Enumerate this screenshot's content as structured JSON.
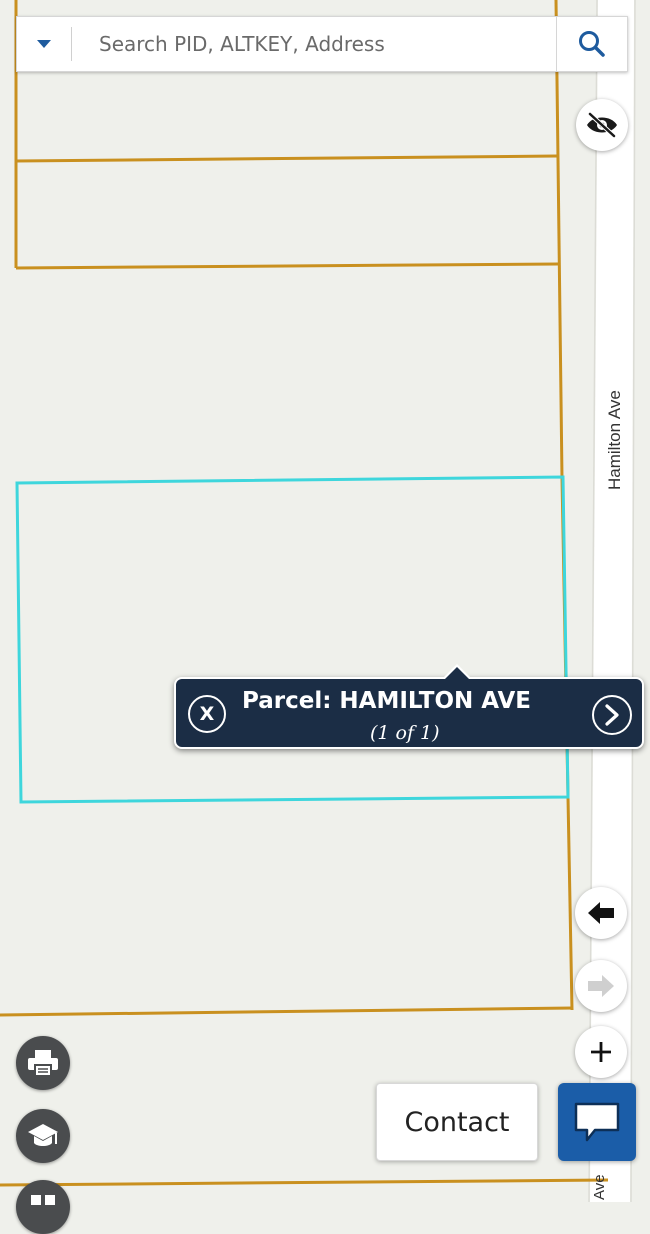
{
  "search": {
    "placeholder": "Search PID, ALTKEY, Address"
  },
  "map": {
    "street_label": "Hamilton Ave",
    "street_label_bottom": "Ave",
    "colors": {
      "background": "#eff0eb",
      "parcel_line": "#c9901f",
      "selected_parcel": "#3ed6dc",
      "road": "#ffffff"
    }
  },
  "popup": {
    "close_label": "X",
    "title": "Parcel: HAMILTON AVE",
    "subtitle": "(1 of 1)"
  },
  "buttons": {
    "contact_label": "Contact"
  },
  "icons": {
    "search_dropdown": "caret-down-icon",
    "search": "search-icon",
    "hide_layers": "eye-slash-icon",
    "back": "arrow-left-icon",
    "forward": "arrow-right-icon",
    "zoom_in": "plus-icon",
    "print": "printer-icon",
    "tools": "graduation-cap-icon",
    "chat": "chat-bubble-icon"
  },
  "accent_colors": {
    "popup_bg": "#1b2d45",
    "chat_bg": "#1b5da8",
    "dark_button": "#4a4c4e"
  }
}
